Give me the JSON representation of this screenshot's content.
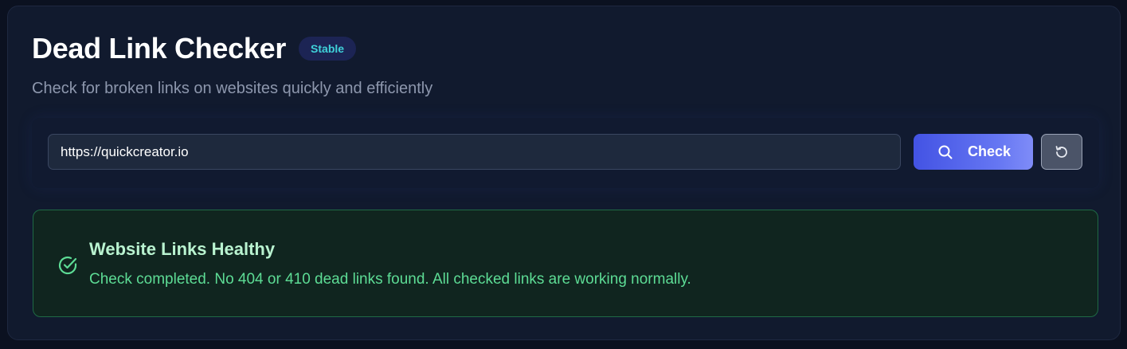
{
  "header": {
    "title": "Dead Link Checker",
    "badge": "Stable",
    "subtitle": "Check for broken links on websites quickly and efficiently"
  },
  "form": {
    "url_value": "https://quickcreator.io",
    "check_label": "Check",
    "check_icon": "search-icon",
    "reset_icon": "reset-icon"
  },
  "result": {
    "icon": "check-circle-icon",
    "title": "Website Links Healthy",
    "message": "Check completed. No 404 or 410 dead links found. All checked links are working normally."
  },
  "colors": {
    "background": "#0b1120",
    "card": "#111a2e",
    "accent": "#4f5fe9",
    "badge_text": "#3fd1d9",
    "success": "#5ddc95"
  }
}
